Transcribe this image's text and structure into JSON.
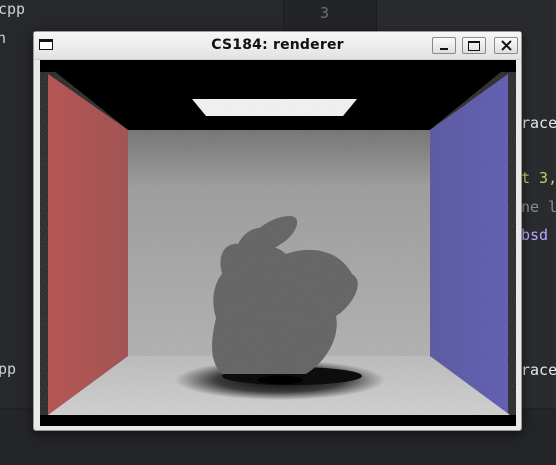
{
  "background_editor": {
    "line_number": "3",
    "left_pane_files": [
      "cpp",
      "n",
      "pp"
    ],
    "code_fragments": [
      "race",
      "t 3,",
      "ne l",
      "bsd",
      "race"
    ]
  },
  "window": {
    "title": "CS184: renderer",
    "controls": {
      "minimize": "minimize",
      "maximize": "maximize",
      "close": "close"
    }
  },
  "scene": {
    "description_icon": "cornell-box-bunny-render",
    "colors": {
      "left_wall": "#c25c5c",
      "right_wall": "#6a67c0",
      "back_wall": "#b2b2b2",
      "ceiling": "#050505",
      "floor": "#d6d6d6",
      "light": "#ffffff",
      "bunny": "#6e6e6e"
    }
  }
}
